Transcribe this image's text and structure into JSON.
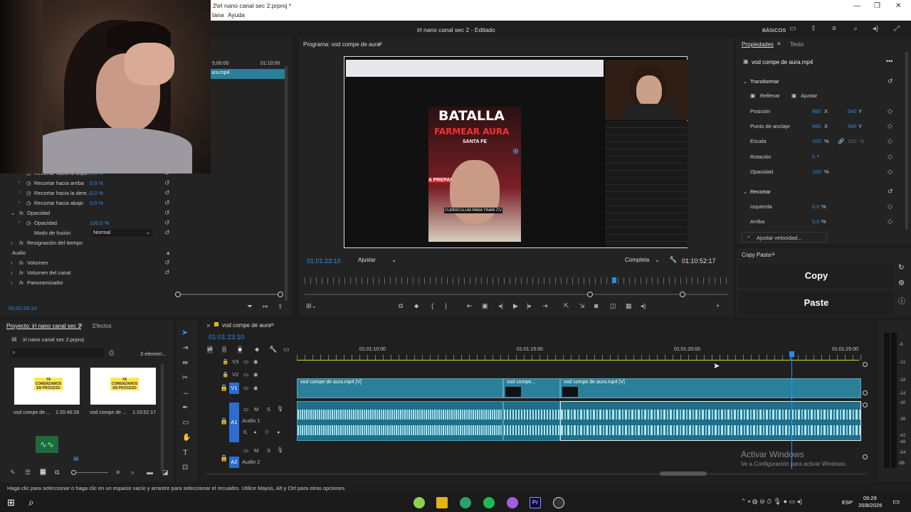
{
  "window": {
    "title_fragment": "2\\irl nano canal sec 2.prproj *",
    "menu_fragment_1": "tana",
    "menu_fragment_2": "Ayuda"
  },
  "header": {
    "title": "irl nano canal sec 2 - Editado",
    "workspace": "BÁSICOS"
  },
  "effect_controls": {
    "timecode_a": "5;00:00",
    "timecode_b": "01:10:00",
    "clip_label": "ura.mp4",
    "rows": [
      {
        "label": "Recortar hacia la izqui...",
        "value": "0,0 %"
      },
      {
        "label": "Recortar hacia arriba",
        "value": "0,0 %"
      },
      {
        "label": "Recortar hacia la dere...",
        "value": "0,0 %"
      },
      {
        "label": "Recortar hacia abajo",
        "value": "0,0 %"
      }
    ],
    "opacity_group": "Opacidad",
    "opacity_label": "Opacidad",
    "opacity_value": "100,0 %",
    "blend_label": "Modo de fusión",
    "blend_value": "Normal",
    "time_remap": "Resignación del tiempo",
    "audio": "Audio",
    "volume": "Volumen",
    "channel_volume": "Volumen del canal",
    "panner": "Panoramizador",
    "timecode": "01:01:23:10"
  },
  "program": {
    "tab": "Programa: vod compe de aura",
    "timecode": "01:01:23:10",
    "fit": "Ajustar",
    "quality": "Completa",
    "duration": "01:10:52:17",
    "video_text": {
      "title1": "BATALLA",
      "title2": "FARMEAR AURA",
      "subtitle": "SANTA FE",
      "caption": "CURRICULUM PARA TINAR CV",
      "banner": "A PREPAR"
    }
  },
  "properties": {
    "tab1": "Propiedades",
    "tab2": "Texto",
    "clip": "vod compe de aura.mp4",
    "transform": "Transformar",
    "fill": "Rellenar",
    "fit": "Ajustar",
    "position": {
      "label": "Posición",
      "x": "960",
      "xu": "X",
      "y": "540",
      "yu": "Y"
    },
    "anchor": {
      "label": "Punto de anclaje",
      "x": "960",
      "xu": "X",
      "y": "540",
      "yu": "Y"
    },
    "scale": {
      "label": "Escala",
      "v1": "100",
      "u1": "%",
      "v2": "100",
      "u2": "%"
    },
    "rotation": {
      "label": "Rotación",
      "v": "0",
      "u": "°"
    },
    "opacity": {
      "label": "Opacidad",
      "v": "100",
      "u": "%"
    },
    "crop": "Recortar",
    "left": {
      "label": "Izquierda",
      "v": "0,0",
      "u": "%"
    },
    "top": {
      "label": "Arriba",
      "v": "0,0",
      "u": "%"
    },
    "speed_btn": "Ajustar velocidad..."
  },
  "copy_paste": {
    "title": "Copy Pasta",
    "copy": "Copy",
    "paste": "Paste"
  },
  "project": {
    "tab": "Proyecto: irl nano canal sec 2",
    "tab2": "Efectos",
    "file": "irl nano canal sec 2.prproj",
    "count": "3 elemen...",
    "items": [
      {
        "name": "vod compe de ...",
        "dur": "1:20:46:28",
        "thumb_text": "YA COMENZAMOS EN PROCESO"
      },
      {
        "name": "vod compe de ...",
        "dur": "1:10:52:17",
        "thumb_text": "YA COMENZAMOS EN PROCESO"
      }
    ]
  },
  "timeline": {
    "tab": "vod compe de aura",
    "timecode": "01:01:23:10",
    "ruler": [
      "01:01:10:00",
      "01:01:15:00",
      "01:01:20:00",
      "01:01:25:00"
    ],
    "tracks": {
      "v3": "V3",
      "v2": "V2",
      "v1": "V1",
      "a1": "A1",
      "a1_name": "Audio 1",
      "a2": "A2",
      "a2_name": "Audio 2",
      "a1_vol": "0,"
    },
    "clips": [
      "vod compe de aura.mp4 [V]",
      "vod compe...",
      "vod compe de aura.mp4 [V]"
    ]
  },
  "meter_labels": [
    "-6",
    "-12",
    "-18",
    "-24",
    "-30",
    "-36",
    "-42",
    "-48",
    "-54",
    "dB"
  ],
  "watermark": {
    "line1": "Activar Windows",
    "line2": "Ve a Configuración para activar Windows."
  },
  "status": "Haga clic para seleccionar o haga clic en un espacio vacío y arrastre para seleccionar el recuadro. Utilice Mayús, Alt y Ctrl para otras opciones.",
  "taskbar": {
    "lang": "ESP",
    "time": "05:29",
    "date": "20/8/2026"
  }
}
